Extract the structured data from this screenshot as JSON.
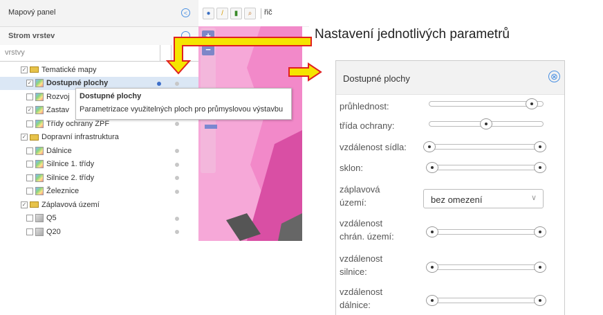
{
  "left_panel": {
    "title": "Mapový panel",
    "tree_title": "Strom vrstev",
    "filter_label": "vrstvy",
    "items": [
      {
        "label": "Tematické mapy",
        "type": "group",
        "checked": true
      },
      {
        "label": "Dostupné plochy",
        "type": "layer",
        "checked": true,
        "selected": true
      },
      {
        "label": "Rozvoj",
        "type": "layer",
        "checked": false
      },
      {
        "label": "Zastav",
        "type": "layer",
        "checked": true
      },
      {
        "label": "Třídy ochrany ZPF",
        "type": "layer",
        "checked": false
      },
      {
        "label": "Dopravní infrastruktura",
        "type": "group",
        "checked": true
      },
      {
        "label": "Dálnice",
        "type": "layer",
        "checked": false
      },
      {
        "label": "Silnice 1. třídy",
        "type": "layer",
        "checked": false
      },
      {
        "label": "Silnice 2. třídy",
        "type": "layer",
        "checked": false
      },
      {
        "label": "Železnice",
        "type": "layer",
        "checked": false
      },
      {
        "label": "Záplavová území",
        "type": "group",
        "checked": true
      },
      {
        "label": "Q5",
        "type": "layer",
        "checked": false
      },
      {
        "label": "Q20",
        "type": "layer",
        "checked": false
      }
    ]
  },
  "tooltip": {
    "title": "Dostupné plochy",
    "text": "Parametrizace využitelných ploch pro průmyslovou výstavbu"
  },
  "toolbar": {
    "partial_label": "řič"
  },
  "map": {
    "zoom_in": "+",
    "zoom_out": "−"
  },
  "annotation": "Nastavení jednotlivých parametrů",
  "param_panel": {
    "title": "Dostupné plochy",
    "close_icon": "⊗",
    "params": [
      {
        "label": "průhlednost:",
        "kind": "slider",
        "values": [
          0.9
        ]
      },
      {
        "label": "třída ochrany:",
        "kind": "slider",
        "values": [
          0.5
        ]
      },
      {
        "label": "vzdálenost sídla:",
        "kind": "slider",
        "values": [
          0.0,
          1.0
        ]
      },
      {
        "label": "sklon:",
        "kind": "slider",
        "values": [
          0.0,
          1.0
        ]
      },
      {
        "label1": "záplavová",
        "label2": "území:",
        "kind": "select",
        "value": "bez omezení"
      },
      {
        "label1": "vzdálenost",
        "label2": "chrán. území:",
        "kind": "slider",
        "values": [
          0.0,
          1.0
        ]
      },
      {
        "label1": "vzdálenost",
        "label2": "silnice:",
        "kind": "slider",
        "values": [
          0.0,
          1.0
        ]
      },
      {
        "label1": "vzdálenost",
        "label2": "dálnice:",
        "kind": "slider",
        "values": [
          0.0,
          1.0
        ]
      }
    ]
  },
  "colors": {
    "map": "#f289c9",
    "accent": "#4a90e2",
    "arrow_fill": "#f5e500",
    "arrow_stroke": "#e02020"
  }
}
